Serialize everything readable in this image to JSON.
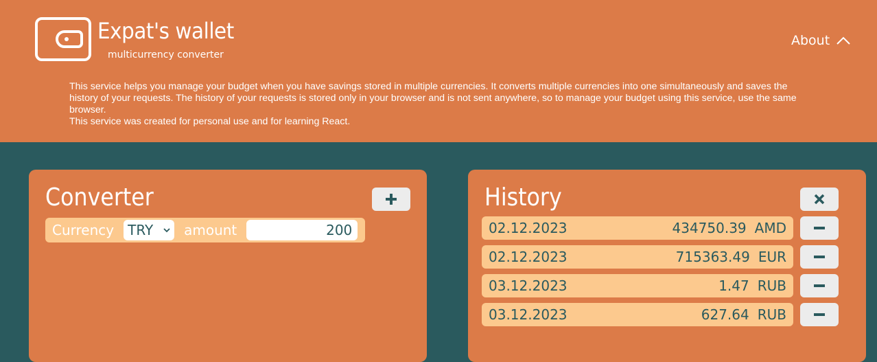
{
  "header": {
    "brand_title": "Expat's wallet",
    "brand_subtitle": "multicurrency converter",
    "about_label": "About",
    "description_lines": [
      "This service helps you manage your budget when you have savings stored in multiple currencies. It converts multiple currencies into one simultaneously and saves the history of your requests. The history of your requests is stored only in your browser and is not sent anywhere, so to manage your budget using this service, use the same browser.",
      "This service was created for personal use and for learning React."
    ]
  },
  "converter": {
    "title": "Converter",
    "currency_label": "Currency",
    "selected_currency": "TRY",
    "amount_label": "amount",
    "amount_value": "200"
  },
  "history": {
    "title": "History",
    "rows": [
      {
        "date": "02.12.2023",
        "amount": "434750.39",
        "currency": "AMD"
      },
      {
        "date": "02.12.2023",
        "amount": "715363.49",
        "currency": "EUR"
      },
      {
        "date": "03.12.2023",
        "amount": "1.47",
        "currency": "RUB"
      },
      {
        "date": "03.12.2023",
        "amount": "627.64",
        "currency": "RUB"
      }
    ]
  },
  "colors": {
    "header_bg": "#dc7b48",
    "page_bg": "#2a5a5e",
    "row_bg": "#fcc98e",
    "button_bg": "#ececec"
  },
  "icons": {
    "logo": "wallet-icon",
    "about": "chevron-up-icon",
    "add": "plus-icon",
    "clear": "close-icon",
    "remove": "minus-icon"
  }
}
